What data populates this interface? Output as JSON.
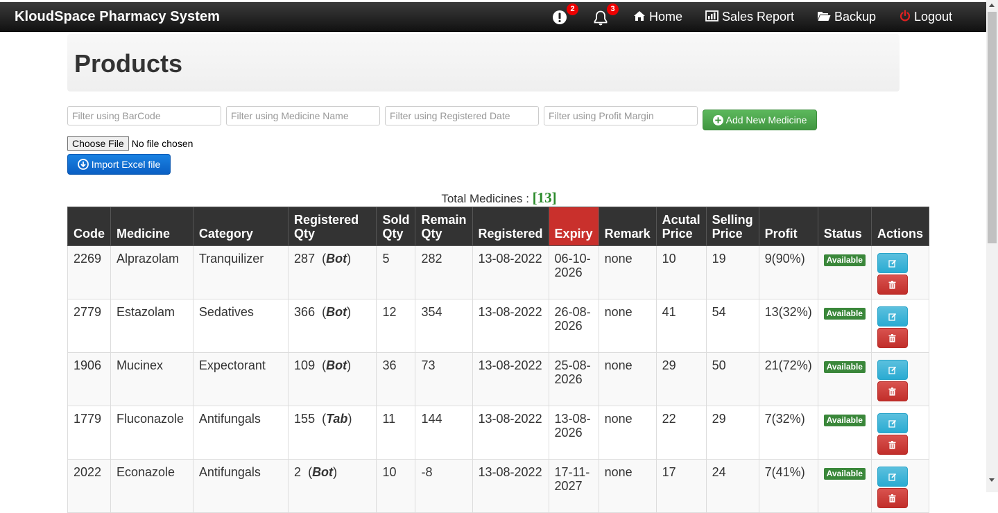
{
  "navbar": {
    "brand": "KloudSpace Pharmacy System",
    "alerts_count": "2",
    "notifications_count": "3",
    "home_label": "Home",
    "sales_report_label": "Sales Report",
    "backup_label": "Backup",
    "logout_label": "Logout"
  },
  "page": {
    "title": "Products"
  },
  "filters": {
    "barcode_placeholder": "Filter using BarCode",
    "medicine_placeholder": "Filter using Medicine Name",
    "date_placeholder": "Filter using Registered Date",
    "profit_placeholder": "Filter using Profit Margin",
    "add_button_label": "Add New Medicine"
  },
  "import": {
    "choose_file_label": "Choose File",
    "no_file_label": "No file chosen",
    "import_button_label": "Import Excel file"
  },
  "summary": {
    "total_label": "Total Medicines :",
    "total_count": "[13]"
  },
  "table": {
    "headers": {
      "code": "Code",
      "medicine": "Medicine",
      "category": "Category",
      "registered_qty_1": "Registered",
      "registered_qty_2": "Qty",
      "sold_qty_1": "Sold",
      "sold_qty_2": "Qty",
      "remain_qty_1": "Remain",
      "remain_qty_2": "Qty",
      "registered": "Registered",
      "expiry": "Expiry",
      "remark": "Remark",
      "actual_price_1": "Acutal",
      "actual_price_2": "Price",
      "selling_price_1": "Selling",
      "selling_price_2": "Price",
      "profit": "Profit",
      "status": "Status",
      "actions": "Actions"
    },
    "rows": [
      {
        "code": "2269",
        "medicine": "Alprazolam",
        "category": "Tranquilizer",
        "reg_qty": "287",
        "unit": "Bot",
        "sold": "5",
        "remain": "282",
        "registered": "13-08-2022",
        "expiry_1": "06-10-",
        "expiry_2": "2026",
        "remark": "none",
        "actual": "10",
        "selling": "19",
        "profit": "9(90%)",
        "status": "Available"
      },
      {
        "code": "2779",
        "medicine": "Estazolam",
        "category": "Sedatives",
        "reg_qty": "366",
        "unit": "Bot",
        "sold": "12",
        "remain": "354",
        "registered": "13-08-2022",
        "expiry_1": "26-08-",
        "expiry_2": "2026",
        "remark": "none",
        "actual": "41",
        "selling": "54",
        "profit": "13(32%)",
        "status": "Available"
      },
      {
        "code": "1906",
        "medicine": "Mucinex",
        "category": "Expectorant",
        "reg_qty": "109",
        "unit": "Bot",
        "sold": "36",
        "remain": "73",
        "registered": "13-08-2022",
        "expiry_1": "25-08-",
        "expiry_2": "2026",
        "remark": "none",
        "actual": "29",
        "selling": "50",
        "profit": "21(72%)",
        "status": "Available"
      },
      {
        "code": "1779",
        "medicine": "Fluconazole",
        "category": "Antifungals",
        "reg_qty": "155",
        "unit": "Tab",
        "sold": "11",
        "remain": "144",
        "registered": "13-08-2022",
        "expiry_1": "13-08-",
        "expiry_2": "2026",
        "remark": "none",
        "actual": "22",
        "selling": "29",
        "profit": "7(32%)",
        "status": "Available"
      },
      {
        "code": "2022",
        "medicine": "Econazole",
        "category": "Antifungals",
        "reg_qty": "2",
        "unit": "Bot",
        "sold": "10",
        "remain": "-8",
        "registered": "13-08-2022",
        "expiry_1": "17-11-",
        "expiry_2": "2027",
        "remark": "none",
        "actual": "17",
        "selling": "24",
        "profit": "7(41%)",
        "status": "Available"
      }
    ]
  }
}
